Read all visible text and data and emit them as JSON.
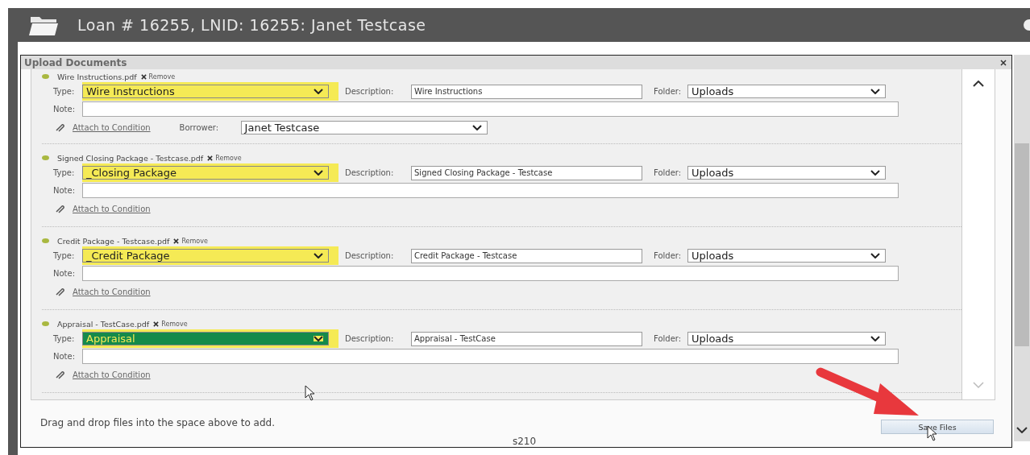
{
  "window": {
    "title": "Loan # 16255, LNID: 16255: Janet Testcase"
  },
  "dialog": {
    "title": "Upload Documents",
    "documents": [
      {
        "file": "Wire Instructions.pdf",
        "remove": "Remove",
        "type_label": "Type:",
        "type": "Wire Instructions",
        "highlighted": true,
        "focused": false,
        "description_label": "Description:",
        "description": "Wire Instructions",
        "folder_label": "Folder:",
        "folder": "Uploads",
        "note_label": "Note:",
        "attach": "Attach to Condition",
        "borrower_label": "Borrower:",
        "borrower": "Janet Testcase"
      },
      {
        "file": "Signed Closing Package - Testcase.pdf",
        "remove": "Remove",
        "type_label": "Type:",
        "type": "_Closing Package",
        "highlighted": true,
        "focused": false,
        "description_label": "Description:",
        "description": "Signed Closing Package - Testcase",
        "folder_label": "Folder:",
        "folder": "Uploads",
        "note_label": "Note:",
        "attach": "Attach to Condition"
      },
      {
        "file": "Credit Package - Testcase.pdf",
        "remove": "Remove",
        "type_label": "Type:",
        "type": "_Credit Package",
        "highlighted": true,
        "focused": false,
        "description_label": "Description:",
        "description": "Credit Package - Testcase",
        "folder_label": "Folder:",
        "folder": "Uploads",
        "note_label": "Note:",
        "attach": "Attach to Condition"
      },
      {
        "file": "Appraisal - TestCase.pdf",
        "remove": "Remove",
        "type_label": "Type:",
        "type": "Appraisal",
        "highlighted": true,
        "focused": true,
        "description_label": "Description:",
        "description": "Appraisal - TestCase",
        "folder_label": "Folder:",
        "folder": "Uploads",
        "note_label": "Note:",
        "attach": "Attach to Condition"
      }
    ],
    "drop_hint": "Drag and drop files into the space above to add.",
    "save_button": "Save Files",
    "footer_code": "s210"
  }
}
